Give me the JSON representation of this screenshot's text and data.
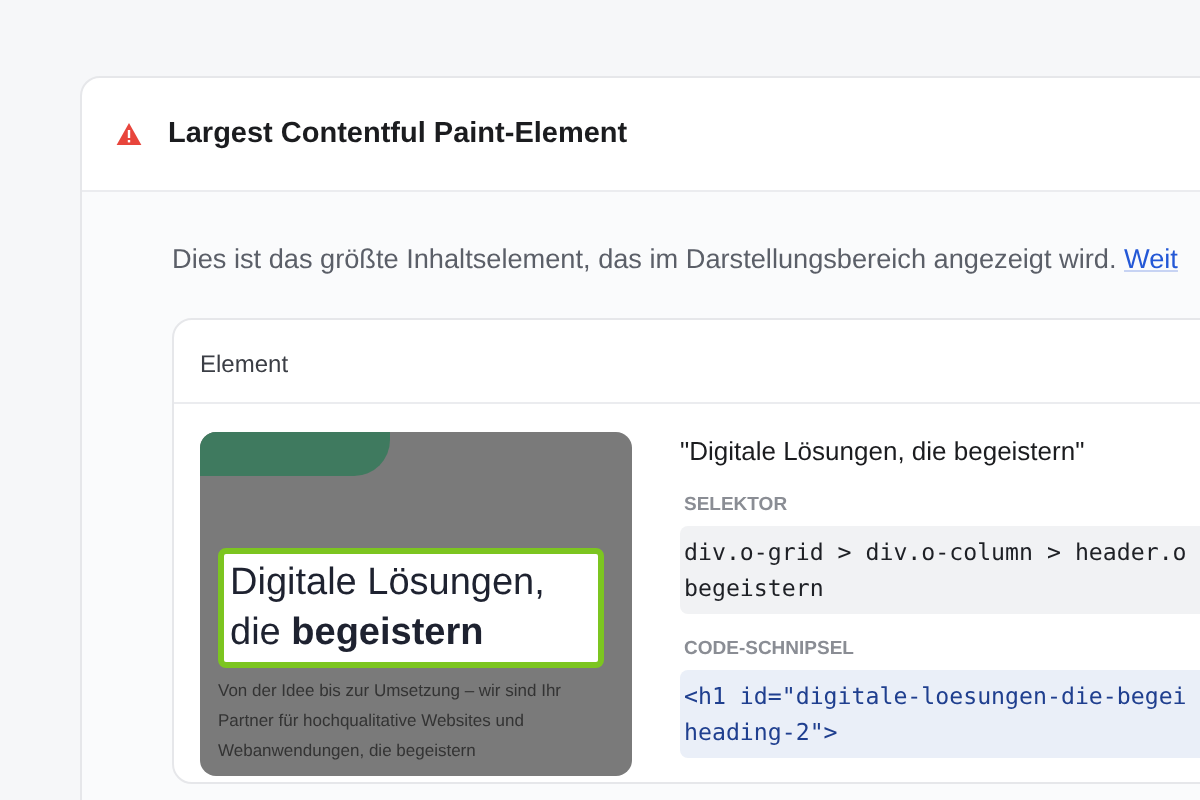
{
  "audit": {
    "title": "Largest Contentful Paint-Element",
    "description": "Dies ist das größte Inhaltselement, das im Darstellungsbereich angezeigt wird.",
    "link": "Weit"
  },
  "element_table": {
    "header": "Element",
    "preview": {
      "heading": "Digitale Lösungen, die **begeistern**",
      "body": "Von der Idee bis zur Umsetzung – wir sind Ihr Partner für hochqualitative Websites und Webanwendungen, die begeistern"
    },
    "node_label": "\"Digitale Lösungen, die begeistern\"",
    "selector_label": "SELEKTOR",
    "selector_lines": [
      "div.o-grid > div.o-column > header.o",
      "begeistern"
    ],
    "snippet_label": "CODE-SCHNIPSEL",
    "snippet_lines": [
      "<h1 id=\"digitale-loesungen-die-begei",
      "heading-2\">"
    ]
  }
}
